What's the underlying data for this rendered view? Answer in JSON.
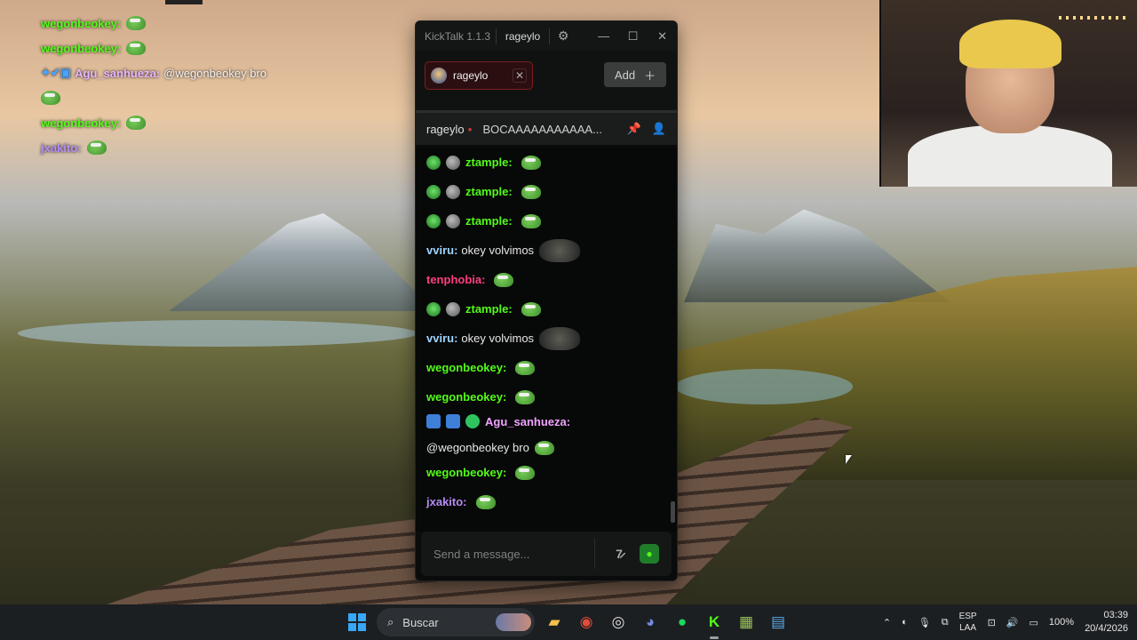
{
  "overlay": {
    "lines": [
      {
        "user": "wegonbeokey:",
        "text": ""
      },
      {
        "user": "wegonbeokey:",
        "text": ""
      },
      {
        "user": "Agu_sanhueza:",
        "text": "@wegonbeokey bro"
      },
      {
        "user": "",
        "text": ""
      },
      {
        "user": "wegonbeokey:",
        "text": ""
      },
      {
        "user": "jxakito:",
        "text": ""
      }
    ]
  },
  "window": {
    "app_name": "KickTalk 1.1.3",
    "channel": "rageylo",
    "tab_label": "rageylo",
    "add_label": "Add",
    "stream_user": "rageylo",
    "stream_title": "BOCAAAAAAAAAAA...",
    "composer_placeholder": "Send a message..."
  },
  "chat": [
    {
      "user": "ztample:",
      "color": "#53fc18",
      "badges": [
        "alien",
        "moon"
      ],
      "text": ""
    },
    {
      "user": "ztample:",
      "color": "#53fc18",
      "badges": [
        "alien",
        "moon"
      ],
      "text": ""
    },
    {
      "user": "ztample:",
      "color": "#53fc18",
      "badges": [
        "alien",
        "moon"
      ],
      "text": ""
    },
    {
      "user": "vviru:",
      "color": "#9fd5ff",
      "badges": [],
      "text": "okey volvimos"
    },
    {
      "user": "tenphobia:",
      "color": "#ff3f7f",
      "badges": [],
      "text": ""
    },
    {
      "user": "ztample:",
      "color": "#53fc18",
      "badges": [
        "alien",
        "moon"
      ],
      "text": ""
    },
    {
      "user": "vviru:",
      "color": "#9fd5ff",
      "badges": [],
      "text": "okey volvimos"
    },
    {
      "user": "wegonbeokey:",
      "color": "#53fc18",
      "badges": [],
      "text": ""
    },
    {
      "user": "wegonbeokey:",
      "color": "#53fc18",
      "badges": [],
      "text": ""
    },
    {
      "user": "Agu_sanhueza:",
      "color": "#f0a3ff",
      "badges": [
        "sq",
        "sq",
        "chk"
      ],
      "text": "@wegonbeokey bro"
    },
    {
      "user": "wegonbeokey:",
      "color": "#53fc18",
      "badges": [],
      "text": ""
    },
    {
      "user": "jxakito:",
      "color": "#b48cf4",
      "badges": [],
      "text": ""
    }
  ],
  "taskbar": {
    "search_label": "Buscar",
    "lang_top": "ESP",
    "lang_bottom": "LAA",
    "battery": "100%",
    "time": "03:39",
    "date": "20/4/2026"
  },
  "colors": {
    "kick_green": "#53fc18",
    "tab_border": "#7a1e20"
  }
}
